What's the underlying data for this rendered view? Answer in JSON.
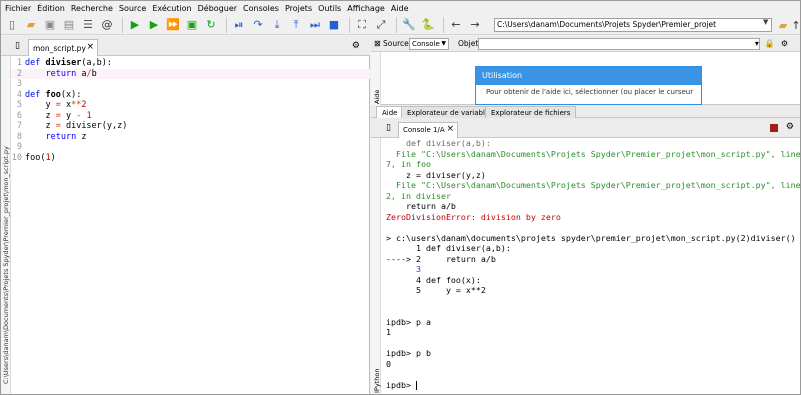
{
  "menu": [
    "Fichier",
    "Édition",
    "Recherche",
    "Source",
    "Exécution",
    "Déboguer",
    "Consoles",
    "Projets",
    "Outils",
    "Affichage",
    "Aide"
  ],
  "toolbar": {
    "path_value": "C:\\Users\\danam\\Documents\\Projets Spyder\\Premier_projet"
  },
  "editor": {
    "tab_label": "mon_script.py",
    "side_path": "C:\\Users\\danam\\Documents\\Projets Spyder\\Premier_projet\\mon_script.py",
    "lines": [
      {
        "n": "1",
        "t": "def diviser(a,b):"
      },
      {
        "n": "2",
        "t": "    return a/b"
      },
      {
        "n": "3",
        "t": ""
      },
      {
        "n": "4",
        "t": "def foo(x):"
      },
      {
        "n": "5",
        "t": "    y = x**2"
      },
      {
        "n": "6",
        "t": "    z = y - 1"
      },
      {
        "n": "7",
        "t": "    z = diviser(y,z)"
      },
      {
        "n": "8",
        "t": "    return z"
      },
      {
        "n": "9",
        "t": ""
      },
      {
        "n": "10",
        "t": "foo(1)"
      }
    ]
  },
  "help": {
    "source_label": "Source",
    "source_value": "Console",
    "object_label": "Objet",
    "side_label": "Aide",
    "usage_title": "Utilisation",
    "usage_body": "Pour obtenir de l'aide ici, sélectionner (ou placer le curseur"
  },
  "pane_tabs": [
    "Aide",
    "Explorateur de variables",
    "Explorateur de fichiers"
  ],
  "console": {
    "tab_label": "Console 1/A",
    "side_label": "IPython",
    "lines": [
      "    def diviser(a,b):",
      "  File \"C:\\Users\\danam\\Documents\\Projets Spyder\\Premier_projet\\mon_script.py\", line",
      "7, in foo",
      "    z = diviser(y,z)",
      "  File \"C:\\Users\\danam\\Documents\\Projets Spyder\\Premier_projet\\mon_script.py\", line",
      "2, in diviser",
      "    return a/b",
      "ZeroDivisionError: division by zero",
      "",
      "> c:\\users\\danam\\documents\\projets spyder\\premier_projet\\mon_script.py(2)diviser()",
      "      1 def diviser(a,b):",
      "----> 2     return a/b",
      "      3",
      "      4 def foo(x):",
      "      5     y = x**2",
      "",
      "",
      "ipdb> p a",
      "1",
      "",
      "ipdb> p b",
      "0",
      "",
      "ipdb> "
    ]
  }
}
